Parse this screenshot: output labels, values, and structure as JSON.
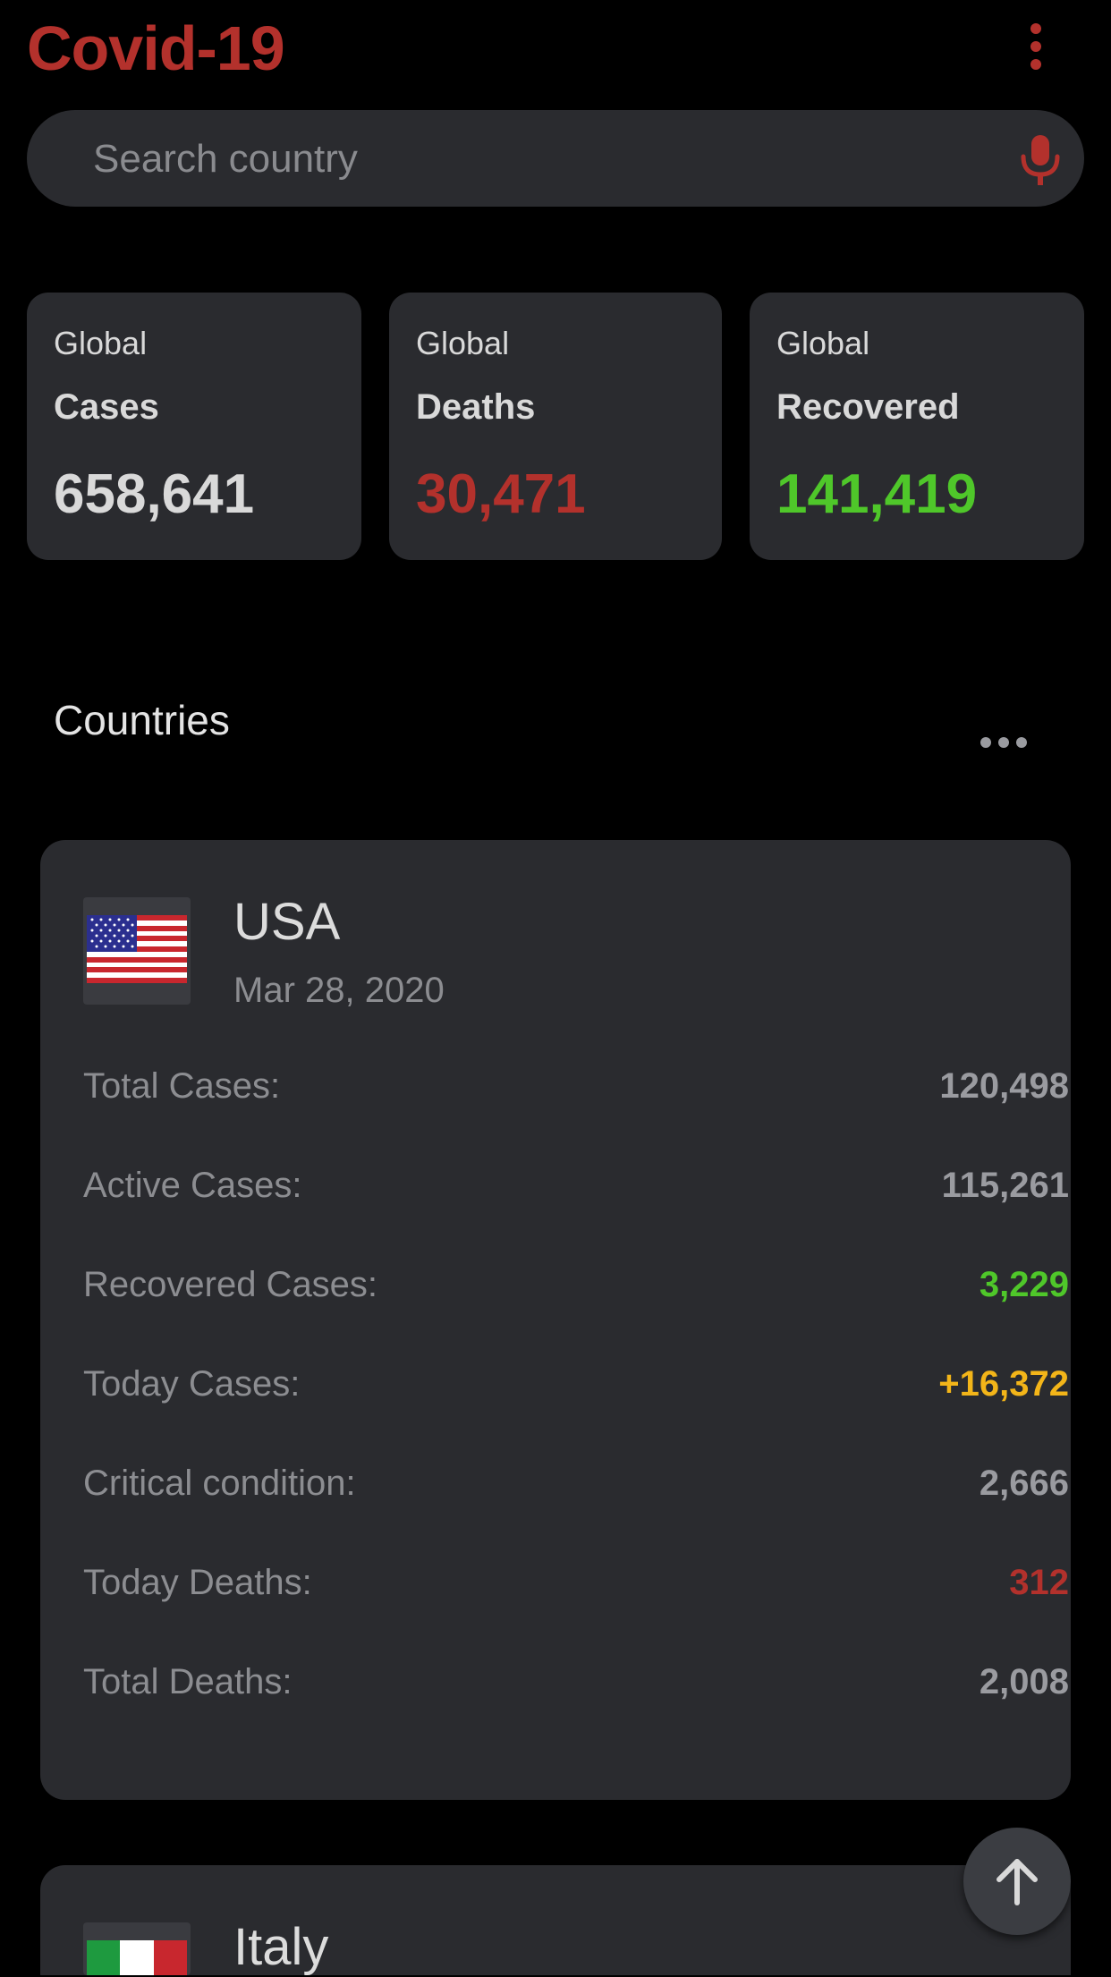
{
  "app": {
    "title": "Covid-19"
  },
  "search": {
    "placeholder": "Search country"
  },
  "global_stats": [
    {
      "scope": "Global",
      "metric": "Cases",
      "value": "658,641",
      "color": "#d9d9d9"
    },
    {
      "scope": "Global",
      "metric": "Deaths",
      "value": "30,471",
      "color": "#b3312c"
    },
    {
      "scope": "Global",
      "metric": "Recovered",
      "value": "141,419",
      "color": "#4fc72a"
    }
  ],
  "countries_section": {
    "title": "Countries"
  },
  "countries": [
    {
      "name": "USA",
      "date": "Mar 28, 2020",
      "flag_icon": "us-flag-icon",
      "stats": [
        {
          "label": "Total Cases:",
          "value": "120,498",
          "color": "#9a9ba0"
        },
        {
          "label": "Active Cases:",
          "value": "115,261",
          "color": "#9a9ba0"
        },
        {
          "label": "Recovered Cases:",
          "value": "3,229",
          "color": "#4fc72a"
        },
        {
          "label": "Today Cases:",
          "value": "+16,372",
          "color": "#f3b519"
        },
        {
          "label": "Critical condition:",
          "value": "2,666",
          "color": "#9a9ba0"
        },
        {
          "label": "Today Deaths:",
          "value": "312",
          "color": "#b3312c"
        },
        {
          "label": "Total Deaths:",
          "value": "2,008",
          "color": "#9a9ba0"
        }
      ]
    },
    {
      "name": "Italy",
      "flag_icon": "italy-flag-icon"
    }
  ],
  "icons": {
    "overflow_menu": "more-vertical-icon",
    "mic": "mic-icon",
    "section_more": "more-horizontal-icon",
    "fab": "arrow-up-icon"
  },
  "colors": {
    "accent": "#b3312c",
    "recovered": "#4fc72a",
    "today": "#f3b519",
    "card": "#2a2b2f",
    "background": "#000000"
  }
}
